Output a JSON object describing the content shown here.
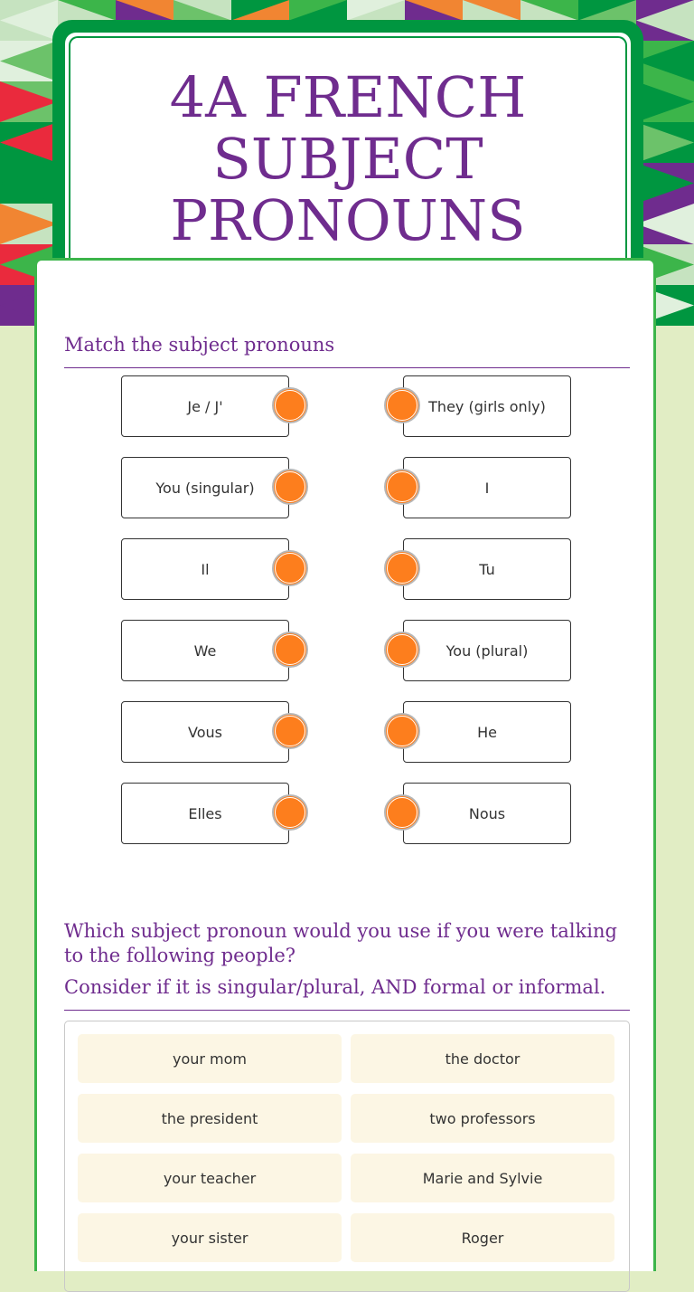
{
  "header": {
    "title": "4A FRENCH SUBJECT PRONOUNS"
  },
  "colors": {
    "accent_purple": "#6f2c8e",
    "dark_green": "#009640",
    "light_green_border": "#3cb54a",
    "dot_orange": "#fd7e1d",
    "tile_bg": "#fcf6e4",
    "page_bg": "#e1edc4"
  },
  "matching": {
    "heading": "Match the subject pronouns",
    "left": [
      "Je / J'",
      "You (singular)",
      "Il",
      "We",
      "Vous",
      "Elles"
    ],
    "right": [
      "They (girls only)",
      "I",
      "Tu",
      "You (plural)",
      "He",
      "Nous"
    ]
  },
  "sorting": {
    "heading_line1": "Which subject pronoun would you use if you were talking to the following people?",
    "heading_line2": "Consider if it is singular/plural, AND formal or informal.",
    "tiles": [
      [
        "your mom",
        "the doctor"
      ],
      [
        "the president",
        "two professors"
      ],
      [
        "your teacher",
        "Marie and Sylvie"
      ],
      [
        "your sister",
        "Roger"
      ]
    ]
  }
}
